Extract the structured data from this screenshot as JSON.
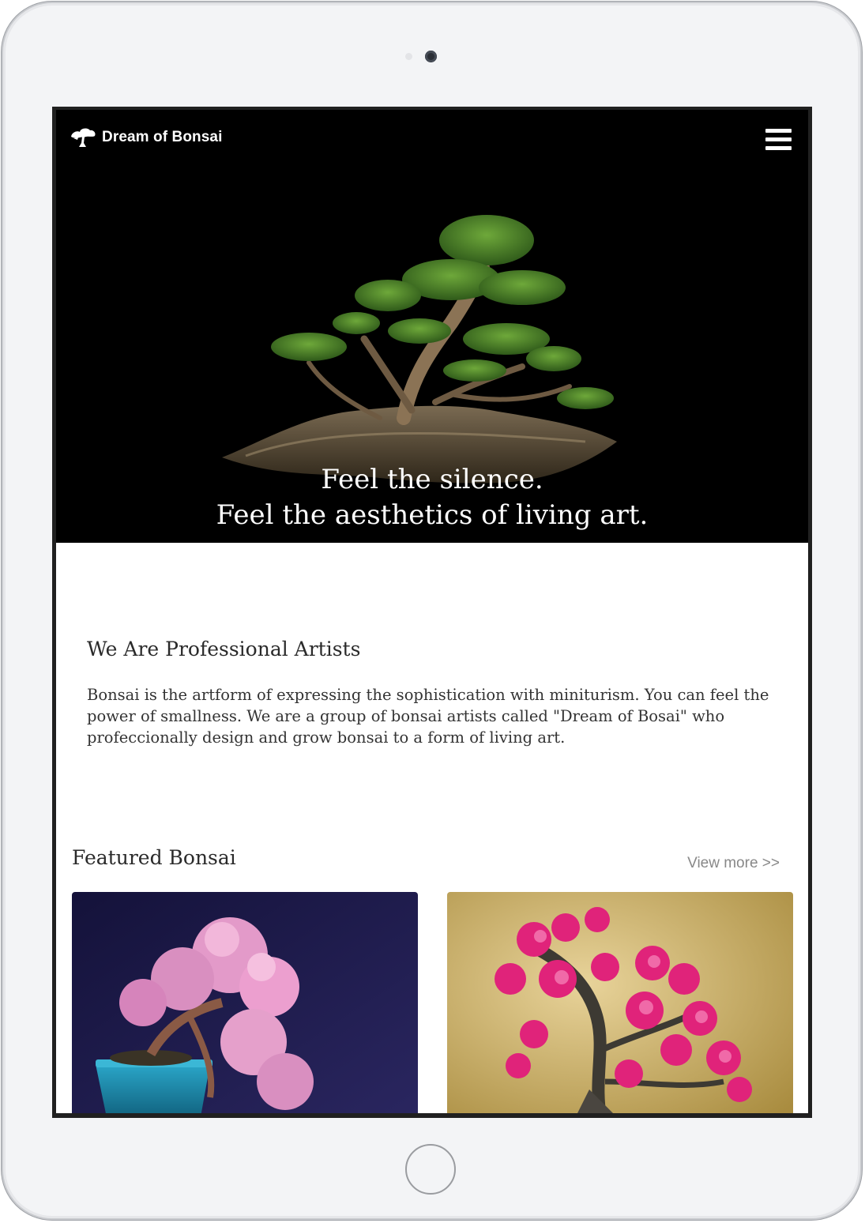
{
  "header": {
    "brand": "Dream of Bonsai",
    "logo_icon": "bonsai-tree-icon",
    "menu_icon": "hamburger-menu-icon"
  },
  "hero": {
    "tagline_line1": "Feel the silence.",
    "tagline_line2": "Feel the aesthetics of living art."
  },
  "about": {
    "title": "We Are Professional Artists",
    "text": "Bonsai is the artform of expressing the sophistication with miniturism. You can feel the power of smallness. We are a group of bonsai artists called \"Dream of Bosai\" who profeccionally design and grow bonsai to a form of living art."
  },
  "featured": {
    "title": "Featured Bonsai",
    "view_more": "View more >>",
    "cards": [
      {
        "subject": "pink azalea bonsai in blue pot",
        "background": "#1e1b4a"
      },
      {
        "subject": "magenta flowering bonsai",
        "background": "#d2b265"
      }
    ]
  },
  "colors": {
    "hero_bg": "#000000",
    "page_bg": "#ffffff",
    "link": "#888888"
  }
}
